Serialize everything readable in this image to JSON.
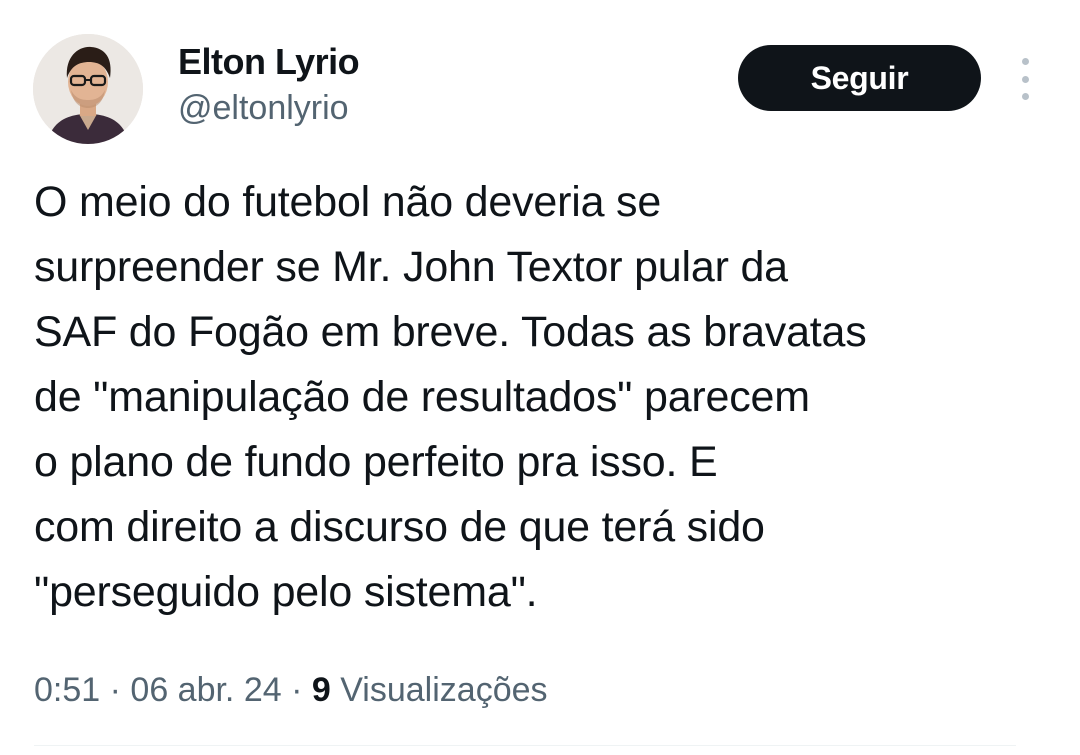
{
  "author": {
    "display_name": "Elton Lyrio",
    "handle": "@eltonlyrio"
  },
  "actions": {
    "follow_label": "Seguir",
    "more_icon": "more-vertical-icon"
  },
  "tweet": {
    "text": "O meio do futebol não deveria se\nsurpreender se Mr. John Textor pular da\nSAF do Fogão em breve. Todas as bravatas\nde \"manipulação de resultados\" parecem\no plano de fundo perfeito pra isso. E\ncom direito a discurso de que terá sido\n\"perseguido pelo sistema\"."
  },
  "meta": {
    "time": "0:51",
    "separator": " · ",
    "date": "06 abr. 24",
    "views_count": "9",
    "views_label": " Visualizações"
  },
  "colors": {
    "primary_text": "#0f1419",
    "secondary_text": "#536471",
    "follow_button_bg": "#0f1419"
  }
}
